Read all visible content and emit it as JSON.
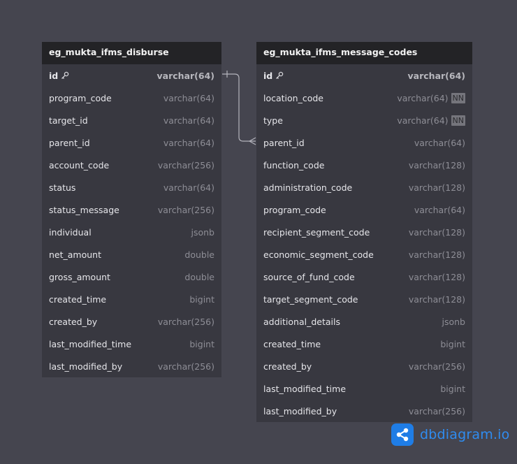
{
  "tables": [
    {
      "name": "eg_mukta_ifms_disburse",
      "fields": [
        {
          "name": "id",
          "type": "varchar(64)",
          "pk": true
        },
        {
          "name": "program_code",
          "type": "varchar(64)"
        },
        {
          "name": "target_id",
          "type": "varchar(64)"
        },
        {
          "name": "parent_id",
          "type": "varchar(64)"
        },
        {
          "name": "account_code",
          "type": "varchar(256)"
        },
        {
          "name": "status",
          "type": "varchar(64)"
        },
        {
          "name": "status_message",
          "type": "varchar(256)"
        },
        {
          "name": "individual",
          "type": "jsonb"
        },
        {
          "name": "net_amount",
          "type": "double"
        },
        {
          "name": "gross_amount",
          "type": "double"
        },
        {
          "name": "created_time",
          "type": "bigint"
        },
        {
          "name": "created_by",
          "type": "varchar(256)"
        },
        {
          "name": "last_modified_time",
          "type": "bigint"
        },
        {
          "name": "last_modified_by",
          "type": "varchar(256)"
        }
      ]
    },
    {
      "name": "eg_mukta_ifms_message_codes",
      "fields": [
        {
          "name": "id",
          "type": "varchar(64)",
          "pk": true
        },
        {
          "name": "location_code",
          "type": "varchar(64)",
          "badge": "NN"
        },
        {
          "name": "type",
          "type": "varchar(64)",
          "badge": "NN"
        },
        {
          "name": "parent_id",
          "type": "varchar(64)"
        },
        {
          "name": "function_code",
          "type": "varchar(128)"
        },
        {
          "name": "administration_code",
          "type": "varchar(128)"
        },
        {
          "name": "program_code",
          "type": "varchar(64)"
        },
        {
          "name": "recipient_segment_code",
          "type": "varchar(128)"
        },
        {
          "name": "economic_segment_code",
          "type": "varchar(128)"
        },
        {
          "name": "source_of_fund_code",
          "type": "varchar(128)"
        },
        {
          "name": "target_segment_code",
          "type": "varchar(128)"
        },
        {
          "name": "additional_details",
          "type": "jsonb"
        },
        {
          "name": "created_time",
          "type": "bigint"
        },
        {
          "name": "created_by",
          "type": "varchar(256)"
        },
        {
          "name": "last_modified_time",
          "type": "bigint"
        },
        {
          "name": "last_modified_by",
          "type": "varchar(256)"
        }
      ]
    }
  ],
  "relationships": [
    {
      "from_table": 0,
      "from_field": "id",
      "to_table": 1,
      "to_field": "parent_id",
      "from_end": "one",
      "to_end": "many"
    }
  ],
  "brand": {
    "name": "dbdiagram.io",
    "icon": "share-nodes-icon",
    "accent": "#1f7de6"
  },
  "colors": {
    "canvas": "#45454f",
    "table_body": "#383840",
    "table_header": "#232326",
    "connector": "#b4b4bc"
  }
}
